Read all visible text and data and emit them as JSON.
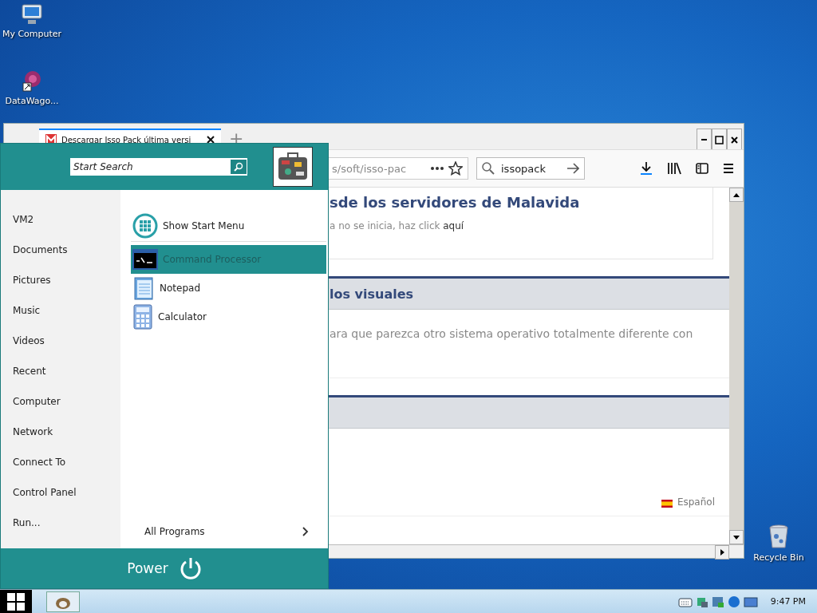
{
  "desktop_icons": [
    {
      "label": "My Computer",
      "kind": "computer"
    },
    {
      "label": "DataWago...",
      "kind": "shortcut"
    },
    {
      "label": "Recycle Bin",
      "kind": "bin"
    }
  ],
  "browser": {
    "tab": {
      "title": "Descargar Isso Pack última versi",
      "selected": true
    },
    "new_tab": "+",
    "address": "s/soft/isso-pac",
    "search": {
      "value": "issopack"
    },
    "page": {
      "heading": "sde los servidores de Malavida",
      "note": "a no se inicia, haz click ",
      "link": "aquí",
      "section_title": "los visuales",
      "section_text": "ara que parezca otro sistema operativo totalmente diferente con",
      "language": "Español"
    }
  },
  "start_menu": {
    "search": {
      "placeholder": "Start Search"
    },
    "places": [
      {
        "label": "VM2"
      },
      {
        "label": "Documents"
      },
      {
        "label": "Pictures"
      },
      {
        "label": "Music"
      },
      {
        "label": "Videos"
      },
      {
        "label": "Recent"
      },
      {
        "label": "Computer"
      },
      {
        "label": "Network"
      },
      {
        "label": "Connect To"
      },
      {
        "label": "Control Panel"
      },
      {
        "label": "Run..."
      }
    ],
    "programs": [
      {
        "label": "Show Start Menu",
        "kind": "tiles",
        "selected": false
      },
      {
        "label": "Command Processor",
        "kind": "console",
        "selected": true
      },
      {
        "label": "Notepad",
        "kind": "notepad",
        "selected": false
      },
      {
        "label": "Calculator",
        "kind": "calculator",
        "selected": false
      }
    ],
    "all_programs": "All Programs",
    "power": "Power"
  },
  "taskbar": {
    "clock": "9:47 PM"
  }
}
